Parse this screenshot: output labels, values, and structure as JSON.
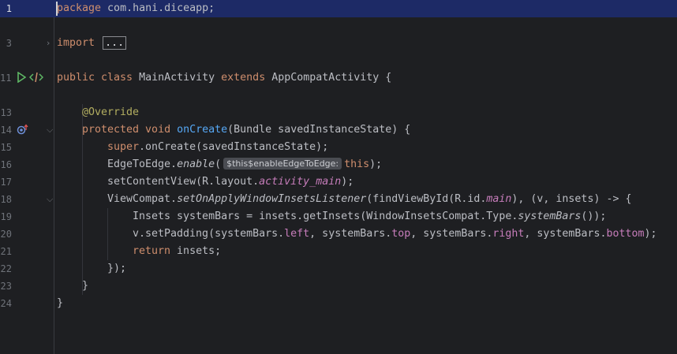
{
  "editor": {
    "line_numbers": [
      "1",
      "3",
      "11",
      "13",
      "14",
      "15",
      "16",
      "17",
      "18",
      "19",
      "20",
      "21",
      "22",
      "23",
      "24"
    ],
    "line1": {
      "kw": "package",
      "rest": " com.hani.diceapp;"
    },
    "line3": {
      "kw": "import",
      "folded": "..."
    },
    "line11": {
      "kw1": "public class",
      "name": " MainActivity ",
      "kw2": "extends",
      "rest": " AppCompatActivity {"
    },
    "line13": {
      "annotation": "@Override"
    },
    "line14": {
      "kw": "protected void",
      "fn": "onCreate",
      "rest": "(Bundle savedInstanceState) {"
    },
    "line15": {
      "kw": "super",
      "rest": ".onCreate(savedInstanceState);"
    },
    "line16": {
      "obj": "EdgeToEdge.",
      "method": "enable",
      "open": "(",
      "hint": "$this$enableEdgeToEdge:",
      "kw": "this",
      "close": ");"
    },
    "line17": {
      "pre": "setContentView(R.layout.",
      "field": "activity_main",
      "post": ");"
    },
    "line18": {
      "obj": "ViewCompat.",
      "method": "setOnApplyWindowInsetsListener",
      "mid": "(findViewById(R.id.",
      "field": "main",
      "post": "), (v, insets) -> {"
    },
    "line19": {
      "pre": "Insets systemBars = insets.getInsets(WindowInsetsCompat.Type.",
      "method": "systemBars",
      "post": "());"
    },
    "line20": {
      "p1": "v.setPadding(systemBars.",
      "f1": "left",
      "p2": ", systemBars.",
      "f2": "top",
      "p3": ", systemBars.",
      "f3": "right",
      "p4": ", systemBars.",
      "f4": "bottom",
      "p5": ");"
    },
    "line21": {
      "kw": "return",
      "rest": " insets;"
    },
    "line22": {
      "text": "});"
    },
    "line23": {
      "text": "}"
    },
    "line24": {
      "text": "}"
    }
  },
  "gutter": {
    "fold_icon_collapsed": "chevron-right-icon",
    "fold_icon_expanded": "chevron-down-icon",
    "run_icon": "run-triangle-icon",
    "code_icon": "code-tag-icon",
    "override_icon": "override-marker-icon"
  },
  "colors": {
    "background": "#1e1f22",
    "current_line": "#1d2a66",
    "keyword": "#cf8e6d",
    "field": "#c77dbb",
    "method": "#56a8f5",
    "annotation": "#b3ae60",
    "text": "#bcbec4",
    "run_icon": "#5fb865"
  }
}
